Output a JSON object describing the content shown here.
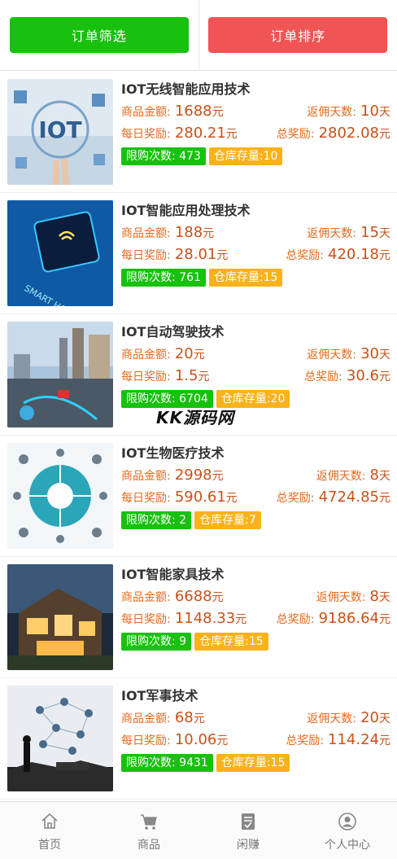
{
  "header": {
    "filter_label": "订单筛选",
    "sort_label": "订单排序"
  },
  "labels": {
    "price": "商品金额:",
    "return_days": "返佣天数:",
    "daily": "每日奖励:",
    "total": "总奖励:",
    "limit": "限购次数:",
    "stock": "仓库存量:",
    "yuan": "元",
    "day": "天"
  },
  "products": [
    {
      "title": "IOT无线智能应用技术",
      "price": "1688",
      "days": "10",
      "daily": "280.21",
      "total": "2802.08",
      "limit": "473",
      "stock": "10",
      "image": "iot-hand-image"
    },
    {
      "title": "IOT智能应用处理技术",
      "price": "188",
      "days": "15",
      "daily": "28.01",
      "total": "420.18",
      "limit": "761",
      "stock": "15",
      "image": "smart-home-phone-image"
    },
    {
      "title": "IOT自动驾驶技术",
      "price": "20",
      "days": "30",
      "daily": "1.5",
      "total": "30.6",
      "limit": "6704",
      "stock": "20",
      "image": "self-driving-city-image"
    },
    {
      "title": "IOT生物医疗技术",
      "price": "2998",
      "days": "8",
      "daily": "590.61",
      "total": "4724.85",
      "limit": "2",
      "stock": "7",
      "image": "medical-diagram-image"
    },
    {
      "title": "IOT智能家具技术",
      "price": "6688",
      "days": "8",
      "daily": "1148.33",
      "total": "9186.64",
      "limit": "9",
      "stock": "15",
      "image": "smart-house-image"
    },
    {
      "title": "IOT军事技术",
      "price": "68",
      "days": "20",
      "daily": "10.06",
      "total": "114.24",
      "limit": "9431",
      "stock": "15",
      "image": "military-network-image"
    }
  ],
  "watermark": "KK源码网",
  "tabbar": [
    {
      "label": "首页",
      "icon": "home-icon"
    },
    {
      "label": "商品",
      "icon": "cart-icon"
    },
    {
      "label": "闲赚",
      "icon": "task-icon"
    },
    {
      "label": "个人中心",
      "icon": "user-icon"
    }
  ],
  "colors": {
    "green": "#17c10d",
    "red": "#f05454",
    "orange": "#f9b21c",
    "value": "#c9511a"
  }
}
